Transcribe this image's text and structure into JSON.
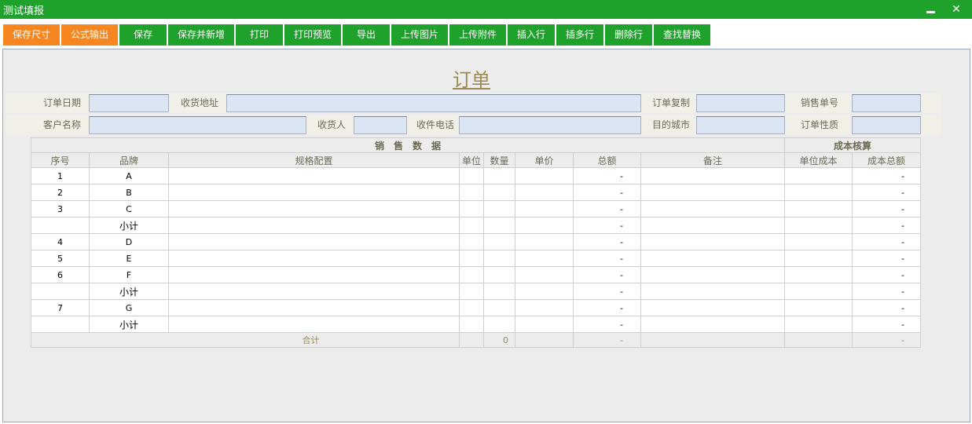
{
  "window": {
    "title": "测试填报",
    "minimize_glyph": "",
    "close_glyph": "✕"
  },
  "toolbar": {
    "buttons": [
      {
        "label": "保存尺寸",
        "style": "orange"
      },
      {
        "label": "公式输出",
        "style": "orange"
      },
      {
        "label": "保存",
        "style": "green"
      },
      {
        "label": "保存并新增",
        "style": "green"
      },
      {
        "label": "打印",
        "style": "green"
      },
      {
        "label": "打印预览",
        "style": "green"
      },
      {
        "label": "导出",
        "style": "green"
      },
      {
        "label": "上传图片",
        "style": "green"
      },
      {
        "label": "上传附件",
        "style": "green"
      },
      {
        "label": "插入行",
        "style": "green"
      },
      {
        "label": "插多行",
        "style": "green"
      },
      {
        "label": "删除行",
        "style": "green"
      },
      {
        "label": "查找替换",
        "style": "green"
      }
    ]
  },
  "form": {
    "title": "订单",
    "fields": {
      "order_date": {
        "label": "订单日期",
        "value": ""
      },
      "ship_address": {
        "label": "收货地址",
        "value": ""
      },
      "order_copy": {
        "label": "订单复制",
        "value": ""
      },
      "sales_no": {
        "label": "销售单号",
        "value": ""
      },
      "customer_name": {
        "label": "客户名称",
        "value": ""
      },
      "consignee": {
        "label": "收货人",
        "value": ""
      },
      "consignee_phone": {
        "label": "收件电话",
        "value": ""
      },
      "dest_city": {
        "label": "目的城市",
        "value": ""
      },
      "order_type": {
        "label": "订单性质",
        "value": ""
      }
    }
  },
  "grid": {
    "group_sales": "销　售　数　据",
    "group_cost": "成本核算",
    "columns": {
      "seq": "序号",
      "brand": "品牌",
      "spec": "规格配置",
      "unit": "单位",
      "qty": "数量",
      "price": "单价",
      "total": "总额",
      "remark": "备注",
      "unit_cost": "单位成本",
      "cost_total": "成本总额"
    },
    "rows": [
      {
        "seq": "1",
        "brand": "A",
        "total": "-",
        "cost_total": "-"
      },
      {
        "seq": "2",
        "brand": "B",
        "total": "-",
        "cost_total": "-"
      },
      {
        "seq": "3",
        "brand": "C",
        "total": "-",
        "cost_total": "-"
      },
      {
        "seq": "",
        "brand": "小计",
        "total": "-",
        "cost_total": "-"
      },
      {
        "seq": "4",
        "brand": "D",
        "total": "-",
        "cost_total": "-"
      },
      {
        "seq": "5",
        "brand": "E",
        "total": "-",
        "cost_total": "-"
      },
      {
        "seq": "6",
        "brand": "F",
        "total": "-",
        "cost_total": "-"
      },
      {
        "seq": "",
        "brand": "小计",
        "total": "-",
        "cost_total": "-"
      },
      {
        "seq": "7",
        "brand": "G",
        "total": "-",
        "cost_total": "-"
      },
      {
        "seq": "",
        "brand": "小计",
        "total": "-",
        "cost_total": "-"
      }
    ],
    "footer": {
      "label": "合计",
      "qty": "0",
      "total": "-",
      "cost_total": "-"
    }
  },
  "colors": {
    "green": "#1fa22c",
    "orange": "#f6861f",
    "field": "#dce5f3",
    "title": "#9c8a55"
  }
}
